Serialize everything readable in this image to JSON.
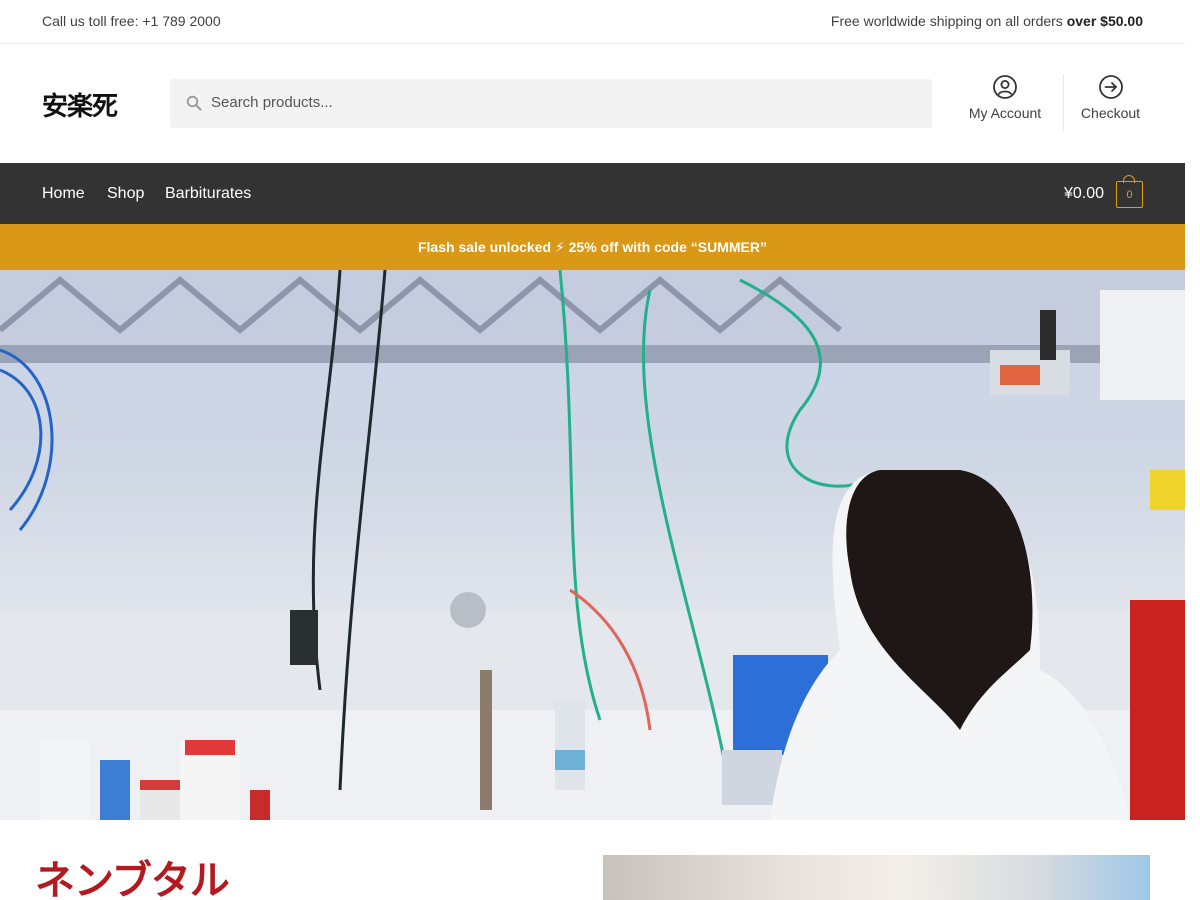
{
  "topbar": {
    "phone_text": "Call us toll free: +1 789 2000",
    "shipping_text": "Free worldwide shipping on all orders ",
    "shipping_bold": "over $50.00"
  },
  "header": {
    "logo": "安楽死",
    "search_placeholder": "Search products...",
    "account_label": "My Account",
    "checkout_label": "Checkout"
  },
  "nav": {
    "items": [
      {
        "label": "Home"
      },
      {
        "label": "Shop"
      },
      {
        "label": "Barbiturates"
      }
    ],
    "cart_total": "¥0.00",
    "cart_count": "0"
  },
  "promo": {
    "text": "Flash sale unlocked ⚡ 25% off with code “SUMMER”"
  },
  "product": {
    "title": "ネンブタル"
  },
  "colors": {
    "accent": "#d99818",
    "nav_bg": "#333333",
    "title_red": "#b3191f"
  },
  "icons": [
    "search-icon",
    "account-icon",
    "checkout-arrow-icon",
    "cart-icon"
  ]
}
